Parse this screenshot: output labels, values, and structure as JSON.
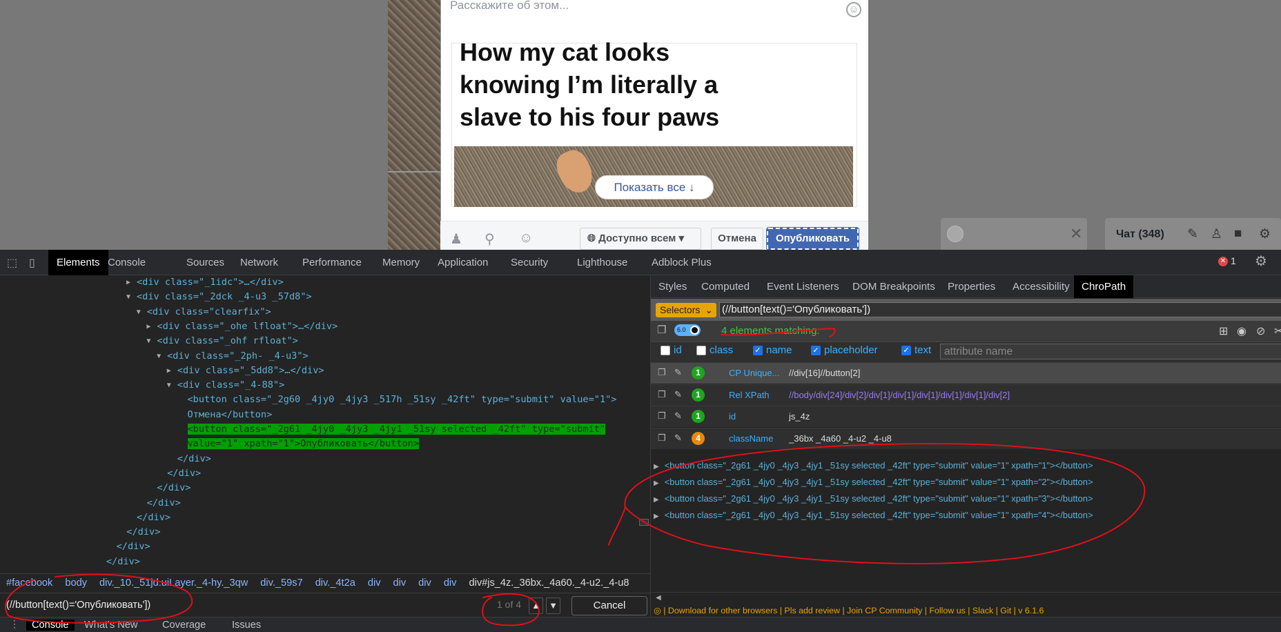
{
  "composer": {
    "prompt": "Расскажите об этом...",
    "emoji_icon": "smiley-icon",
    "meme_caption": "How my cat looks knowing I’m literally a slave to his four paws",
    "show_all": "Показать все ↓",
    "footer_icons": [
      "tag-people-icon",
      "location-pin-icon",
      "feeling-smiley-icon"
    ],
    "audience": "Доступно всем",
    "cancel": "Отмена",
    "publish": "Опубликовать"
  },
  "chat": {
    "title": "Чат (348)",
    "close_glyph": "✕",
    "icons": [
      "compose-icon",
      "group-icon",
      "video-call-icon",
      "settings-gear-icon"
    ]
  },
  "devtools": {
    "tabs": [
      "Elements",
      "Console",
      "Sources",
      "Network",
      "Performance",
      "Memory",
      "Application",
      "Security",
      "Lighthouse",
      "Adblock Plus"
    ],
    "active_tab": "Elements",
    "error_count": "1",
    "elements_lines": [
      {
        "indent": 0,
        "arrow": "▶",
        "html": "<div class=\"_1idc\">…</div>"
      },
      {
        "indent": 0,
        "arrow": "▼",
        "html": "<div class=\"_2dck _4-u3  _57d8\">"
      },
      {
        "indent": 1,
        "arrow": "▼",
        "html": "<div class=\"clearfix\">"
      },
      {
        "indent": 2,
        "arrow": "▶",
        "html": "<div class=\"_ohe lfloat\">…</div>"
      },
      {
        "indent": 2,
        "arrow": "▼",
        "html": "<div class=\"_ohf rfloat\">"
      },
      {
        "indent": 3,
        "arrow": "▼",
        "html": "<div class=\"_2ph- _4-u3\">"
      },
      {
        "indent": 4,
        "arrow": "▶",
        "html": "<div class=\"_5dd8\">…</div>"
      },
      {
        "indent": 4,
        "arrow": "▼",
        "html": "<div class=\"_4-88\">"
      },
      {
        "indent": 5,
        "arrow": "",
        "html": "<button class=\"_2g60 _4jy0 _4jy3 _517h _51sy _42ft\" type=\"submit\" value=\"1\">"
      },
      {
        "indent": 5,
        "arrow": "",
        "html": "Отмена</button>"
      },
      {
        "indent": 5,
        "arrow": "",
        "html": "<button class=\"_2g61 _4jy0 _4jy3 _4jy1 _51sy selected _42ft\" type=\"submit\"",
        "highlight": true
      },
      {
        "indent": 5,
        "arrow": "",
        "html": "value=\"1\" xpath=\"1\">Опубликовать</button>",
        "highlight": true
      },
      {
        "indent": 4,
        "arrow": "",
        "html": "</div>"
      },
      {
        "indent": 3,
        "arrow": "",
        "html": "</div>"
      },
      {
        "indent": 2,
        "arrow": "",
        "html": "</div>"
      },
      {
        "indent": 1,
        "arrow": "",
        "html": "</div>"
      },
      {
        "indent": 0,
        "arrow": "",
        "html": "</div>"
      },
      {
        "indent": -1,
        "arrow": "",
        "html": "</div>"
      },
      {
        "indent": -2,
        "arrow": "",
        "html": "</div>"
      },
      {
        "indent": -3,
        "arrow": "",
        "html": "</div>"
      }
    ],
    "breadcrumbs": [
      "#facebook",
      "body",
      "div._10._51jd.uiLayer._4-hy._3qw",
      "div._59s7",
      "div._4t2a",
      "div",
      "div",
      "div",
      "div",
      "div#js_4z._36bx._4a60._4-u2._4-u8"
    ],
    "find_query": "(//button[text()='Опубликовать'])",
    "find_count": "1 of 4",
    "find_cancel": "Cancel",
    "drawer_tabs": [
      "Console",
      "What's New",
      "Coverage",
      "Issues"
    ]
  },
  "sidebar": {
    "tabs": [
      "Styles",
      "Computed",
      "Event Listeners",
      "DOM Breakpoints",
      "Properties",
      "Accessibility",
      "ChroPath"
    ],
    "active_tab": "ChroPath"
  },
  "chropath": {
    "selector_mode": "Selectors",
    "query": "(//button[text()='Опубликовать'])",
    "version": "6.0",
    "matches": "4 elements matching.",
    "checkboxes": [
      {
        "label": "id",
        "checked": false
      },
      {
        "label": "class",
        "checked": false
      },
      {
        "label": "name",
        "checked": true
      },
      {
        "label": "placeholder",
        "checked": true
      },
      {
        "label": "text",
        "checked": true
      }
    ],
    "attr_placeholder": "attribute name",
    "selectors": [
      {
        "count": "1",
        "color": "#1ea51e",
        "name": "CP Unique...",
        "value": "//div[16]//button[2]"
      },
      {
        "count": "1",
        "color": "#1ea51e",
        "name": "Rel XPath",
        "value": "//body/div[24]/div[2]/div[1]/div[1]/div[1]/div[1]/div[1]/div[2]"
      },
      {
        "count": "1",
        "color": "#1ea51e",
        "name": "id",
        "value": "js_4z"
      },
      {
        "count": "4",
        "color": "#e8890c",
        "name": "className",
        "value": "_36bx _4a60 _4-u2 _4-u8"
      }
    ],
    "results": [
      "<button class=\"_2g61 _4jy0 _4jy3 _4jy1 _51sy selected _42ft\" type=\"submit\" value=\"1\" xpath=\"1\"></button>",
      "<button class=\"_2g61 _4jy0 _4jy3 _4jy1 _51sy selected _42ft\" type=\"submit\" value=\"1\" xpath=\"2\"></button>",
      "<button class=\"_2g61 _4jy0 _4jy3 _4jy1 _51sy selected _42ft\" type=\"submit\" value=\"1\" xpath=\"3\"></button>",
      "<button class=\"_2g61 _4jy0 _4jy3 _4jy1 _51sy selected _42ft\" type=\"submit\" value=\"1\" xpath=\"4\"></button>"
    ],
    "footer": "| Download for other browsers | Pls add review | Join CP Community | Follow us  | Slack | Git | v 6.1.6"
  },
  "colors": {
    "fb_blue": "#4267b2",
    "highlight_green": "#00a000",
    "annotation_red": "#e0101a"
  }
}
